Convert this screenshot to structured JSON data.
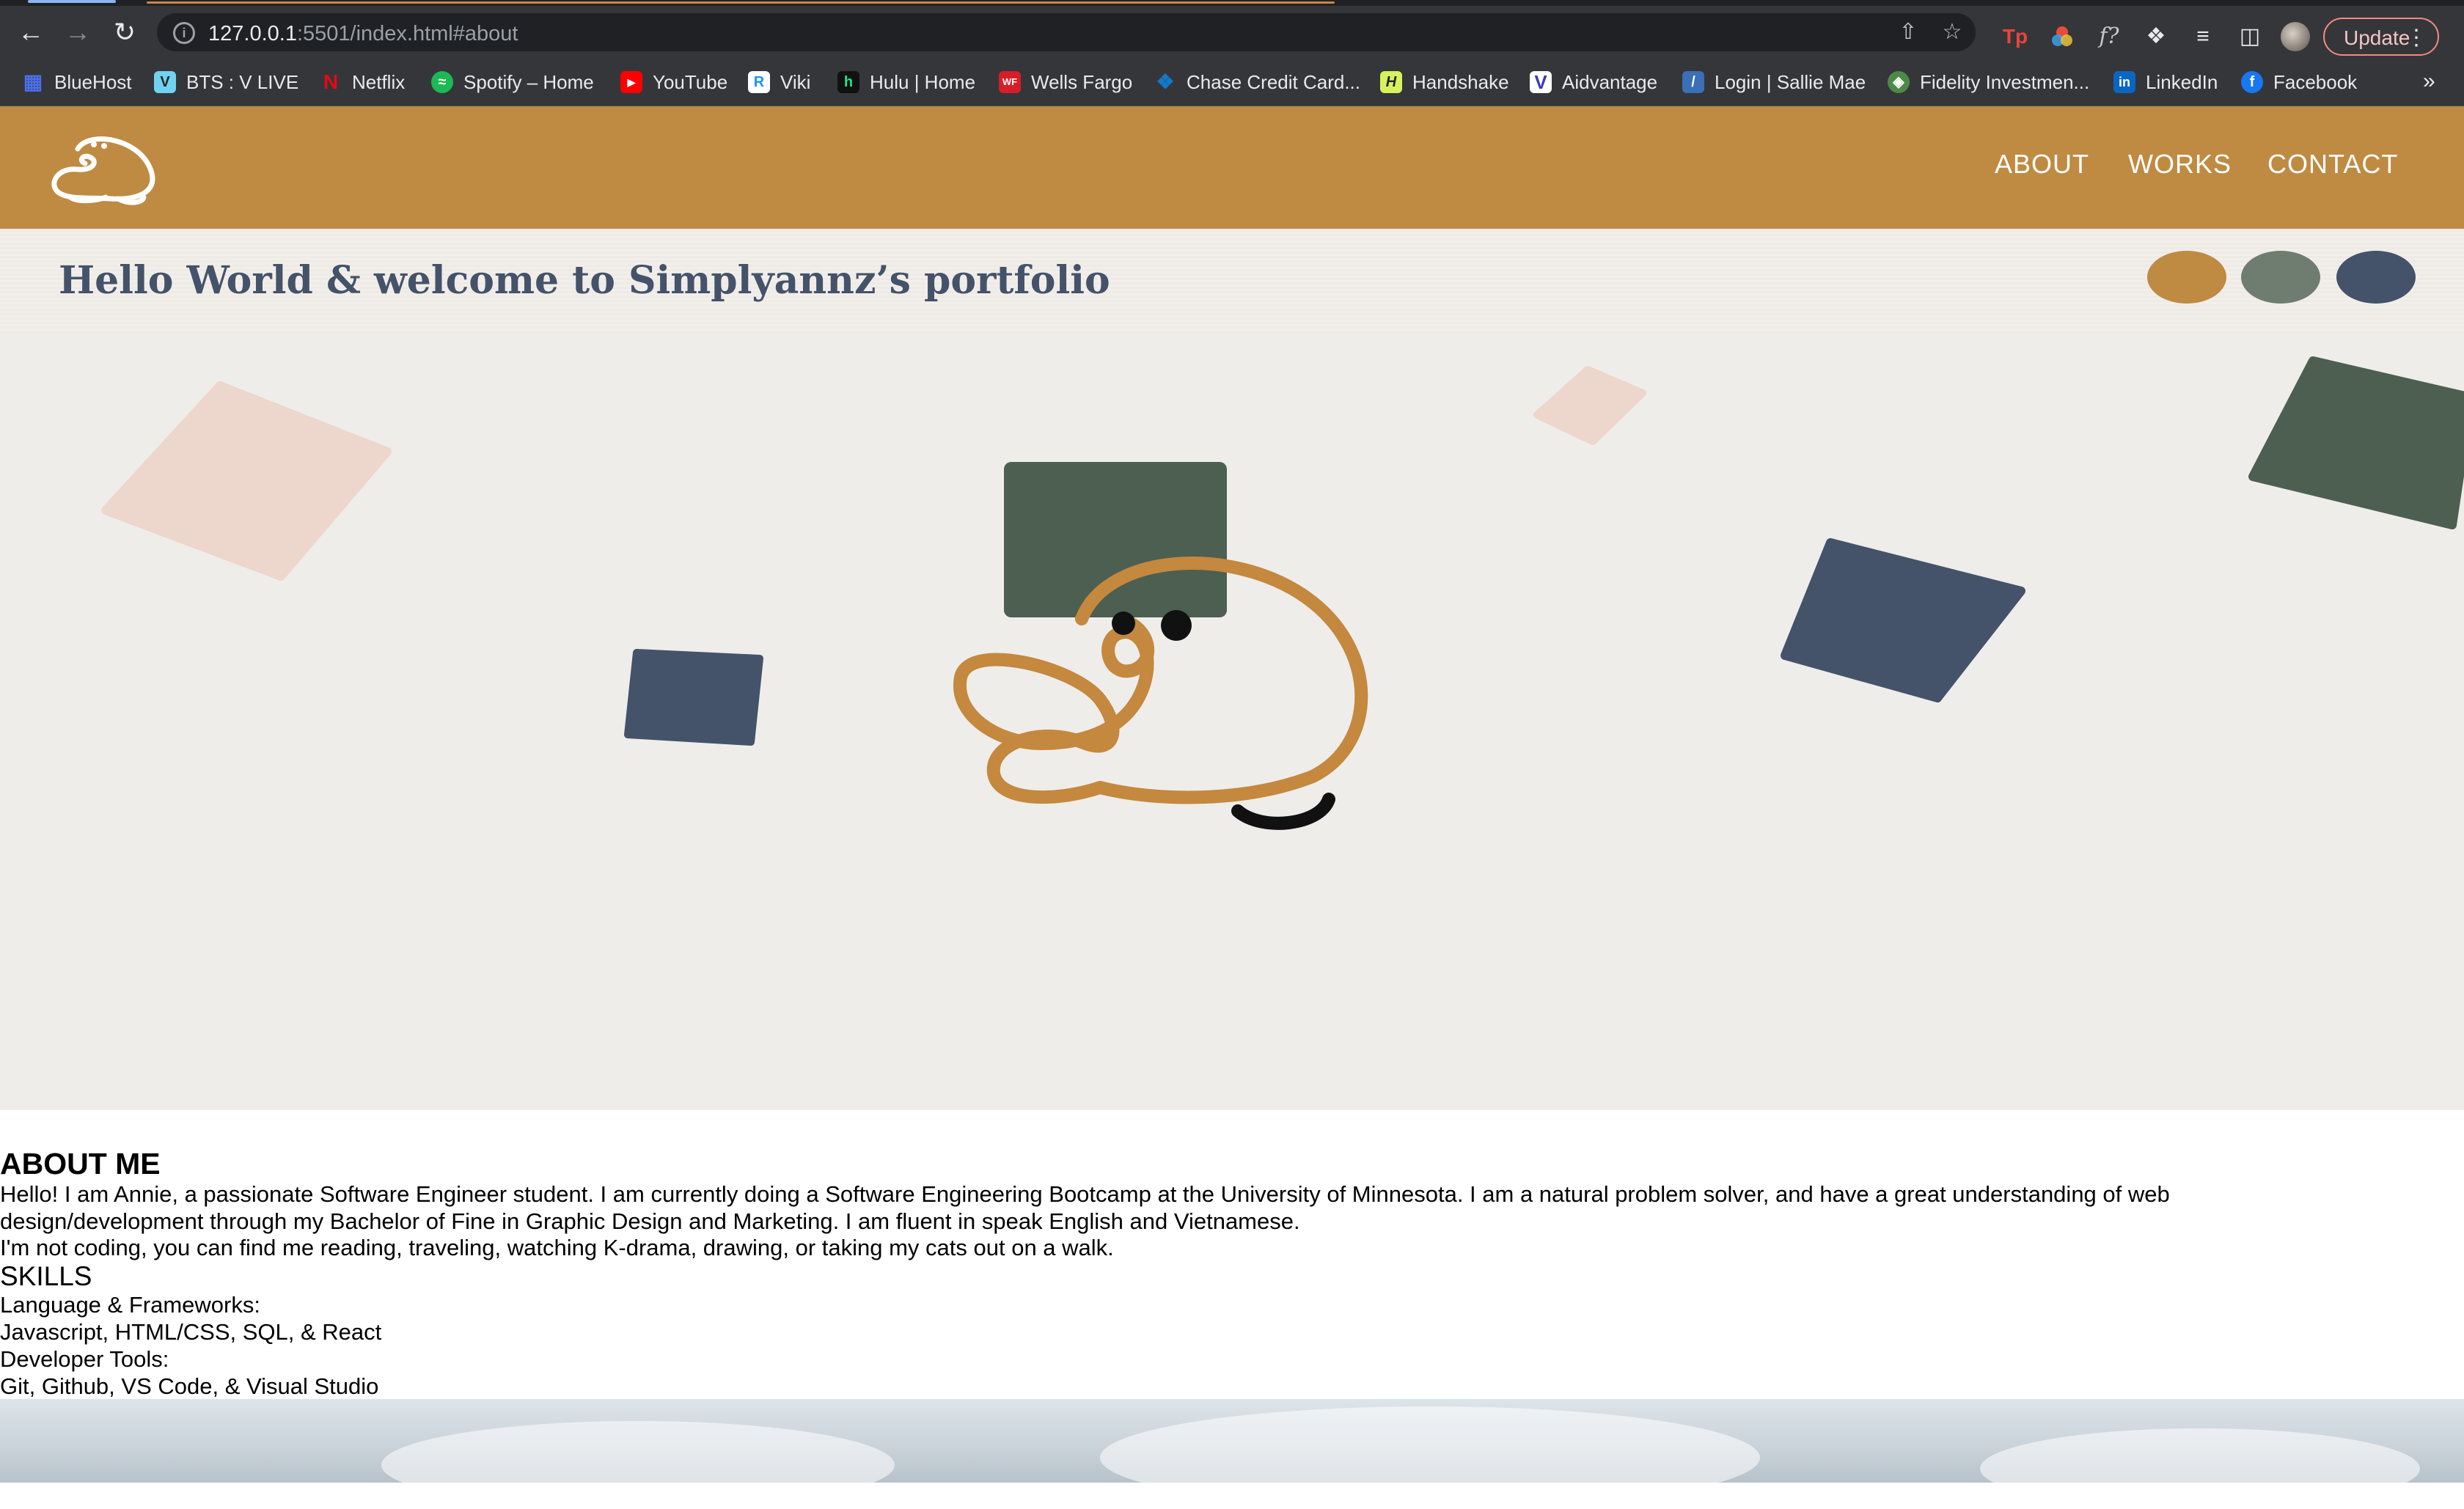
{
  "browser": {
    "url_host": "127.0.0.1",
    "url_rest": ":5501/index.html#about",
    "update_label": "Update",
    "bookmarks": [
      {
        "label": "BlueHost",
        "icon": "grid-icon",
        "color": "#4a6fe8"
      },
      {
        "label": "BTS : V LIVE",
        "icon": "vlive-icon",
        "color": "#6fd3f0"
      },
      {
        "label": "Netflix",
        "icon": "netflix-icon",
        "color": "#e50914"
      },
      {
        "label": "Spotify – Home",
        "icon": "spotify-icon",
        "color": "#1db954"
      },
      {
        "label": "YouTube",
        "icon": "youtube-icon",
        "color": "#ff0000"
      },
      {
        "label": "Viki",
        "icon": "viki-icon",
        "color": "#1e90ff"
      },
      {
        "label": "Hulu | Home",
        "icon": "hulu-icon",
        "color": "#111111"
      },
      {
        "label": "Wells Fargo",
        "icon": "wellsfargo-icon",
        "color": "#d71e28"
      },
      {
        "label": "Chase Credit Card...",
        "icon": "chase-icon",
        "color": "#117aca"
      },
      {
        "label": "Handshake",
        "icon": "handshake-icon",
        "color": "#d6f25c"
      },
      {
        "label": "Aidvantage",
        "icon": "aidvantage-icon",
        "color": "#3c3ab8"
      },
      {
        "label": "Login | Sallie Mae",
        "icon": "salliemae-icon",
        "color": "#3b6fb6"
      },
      {
        "label": "Fidelity Investmen...",
        "icon": "fidelity-icon",
        "color": "#4d8a4a"
      },
      {
        "label": "LinkedIn",
        "icon": "linkedin-icon",
        "color": "#0a66c2"
      },
      {
        "label": "Facebook",
        "icon": "facebook-icon",
        "color": "#1877f2"
      }
    ]
  },
  "colors": {
    "brand_gold": "#bf8a42",
    "green": "#4c5f51",
    "navy": "#44536a",
    "blush": "#edd6cb"
  },
  "header": {
    "nav": [
      {
        "label": "ABOUT"
      },
      {
        "label": "WORKS"
      },
      {
        "label": "CONTACT"
      }
    ]
  },
  "welcome": {
    "text": "Hello World & welcome to Simplyannz’s portfolio",
    "swatches": [
      "#bf8a42",
      "#6e7d6f",
      "#44536a"
    ]
  },
  "about": {
    "title": "ABOUT ME",
    "paragraph": "Hello! I am Annie, a passionate Software Engineer student. I am currently doing a Software Engineering Bootcamp at the University of Minnesota. I am a natural problem solver, and have a great understanding of web design/development through my Bachelor of Fine in Graphic Design and Marketing. I am fluent in speak English and Vietnamese.",
    "hobbies": "I'm not coding, you can find me reading, traveling, watching K-drama, drawing, or taking my cats out on a walk.",
    "skills_title": "SKILLS",
    "languages_label": "Language & Frameworks:",
    "languages": "Javascript, HTML/CSS, SQL, & React",
    "tools_label": "Developer Tools:",
    "tools": "Git, Github, VS Code, & Visual Studio"
  }
}
